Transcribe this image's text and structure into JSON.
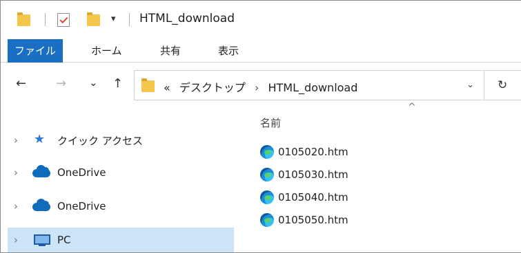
{
  "window": {
    "title": "HTML_download"
  },
  "quick_access_toolbar": {
    "icons": [
      "folder-icon",
      "properties-check-icon",
      "new-folder-icon",
      "customize-dropdown-icon"
    ],
    "dropdown_glyph": "▾"
  },
  "ribbon": {
    "tabs": [
      {
        "label": "ファイル",
        "active": true
      },
      {
        "label": "ホーム",
        "active": false
      },
      {
        "label": "共有",
        "active": false
      },
      {
        "label": "表示",
        "active": false
      }
    ]
  },
  "navigation": {
    "back_glyph": "←",
    "forward_glyph": "→",
    "recent_glyph": "⌄",
    "up_glyph": "↑",
    "refresh_glyph": "↻",
    "address_dropdown_glyph": "⌄"
  },
  "address_bar": {
    "overflow": "«",
    "crumbs": [
      "デスクトップ",
      "HTML_download"
    ],
    "crumb_separator": "›"
  },
  "nav_pane": {
    "items": [
      {
        "label": "クイック アクセス",
        "icon": "star-icon",
        "selected": false
      },
      {
        "label": "OneDrive",
        "icon": "onedrive-icon",
        "selected": false
      },
      {
        "label": "OneDrive",
        "icon": "onedrive-icon",
        "selected": false
      },
      {
        "label": "PC",
        "icon": "pc-icon",
        "selected": true
      }
    ],
    "expander_glyph": "›"
  },
  "file_list": {
    "column_header": "名前",
    "sort_glyph": "^",
    "files": [
      {
        "name": "0105020.htm",
        "icon": "edge-icon"
      },
      {
        "name": "0105030.htm",
        "icon": "edge-icon"
      },
      {
        "name": "0105040.htm",
        "icon": "edge-icon"
      },
      {
        "name": "0105050.htm",
        "icon": "edge-icon"
      }
    ]
  },
  "colors": {
    "active_tab": "#1a6fc4",
    "selected_nav": "#cce4f7",
    "folder": "#f4c64a"
  }
}
